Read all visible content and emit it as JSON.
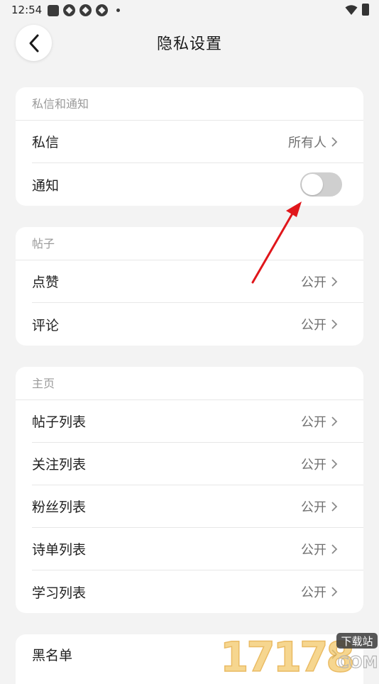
{
  "status_bar": {
    "time": "12:54"
  },
  "header": {
    "title": "隐私设置",
    "back_icon": "chevron-left-icon"
  },
  "sections": {
    "messages": {
      "title": "私信和通知",
      "private_message_label": "私信",
      "private_message_value": "所有人",
      "notification_label": "通知",
      "notification_enabled": false
    },
    "posts": {
      "title": "帖子",
      "items": [
        {
          "label": "点赞",
          "value": "公开"
        },
        {
          "label": "评论",
          "value": "公开"
        }
      ]
    },
    "homepage": {
      "title": "主页",
      "items": [
        {
          "label": "帖子列表",
          "value": "公开"
        },
        {
          "label": "关注列表",
          "value": "公开"
        },
        {
          "label": "粉丝列表",
          "value": "公开"
        },
        {
          "label": "诗单列表",
          "value": "公开"
        },
        {
          "label": "学习列表",
          "value": "公开"
        }
      ]
    },
    "blacklist": {
      "label": "黑名单"
    }
  },
  "watermark": {
    "number": "17178",
    "tag": "下载站",
    "domain": "COM"
  },
  "colors": {
    "background": "#f3f3f3",
    "card": "#ffffff",
    "toggle_off": "#cfcfcf",
    "annotation_arrow": "#e0161b"
  }
}
